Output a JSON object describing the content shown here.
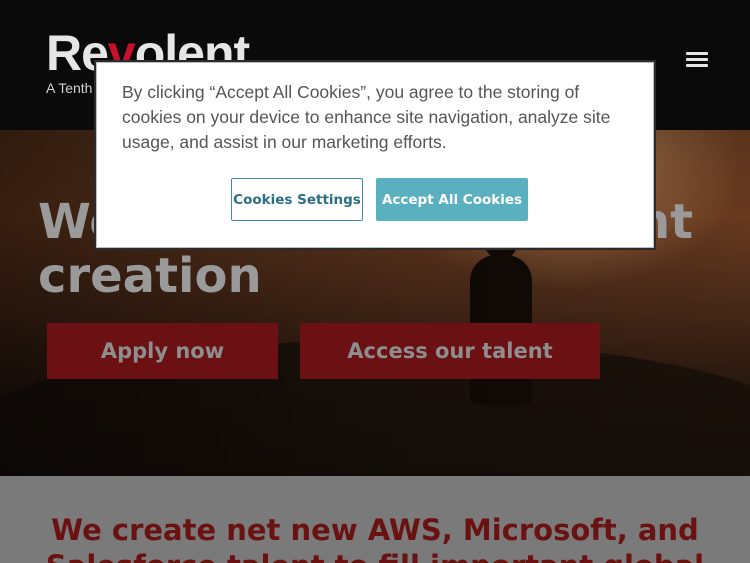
{
  "header": {
    "logo_prefix": "Re",
    "logo_accent": "v",
    "logo_suffix": "olent",
    "tagline": "A Tenth"
  },
  "hero": {
    "title_line1_start": "We",
    "title_line1_end": "nt",
    "title_line2": "creation",
    "apply_label": "Apply now",
    "talent_label": "Access our talent"
  },
  "below": {
    "heading_line1": "We create net new AWS, Microsoft, and",
    "heading_line2": "Salesforce talent to fill important global"
  },
  "cookie": {
    "message": "By clicking “Accept All Cookies”, you agree to the storing of cookies on your device to enhance site navigation, analyze site usage, and assist in our marketing efforts.",
    "settings_label": "Cookies Settings",
    "accept_label": "Accept All Cookies"
  },
  "colors": {
    "brand_red": "#c8102e",
    "button_dark_red": "#6b1114",
    "cookie_accent": "#5bb0bf"
  }
}
